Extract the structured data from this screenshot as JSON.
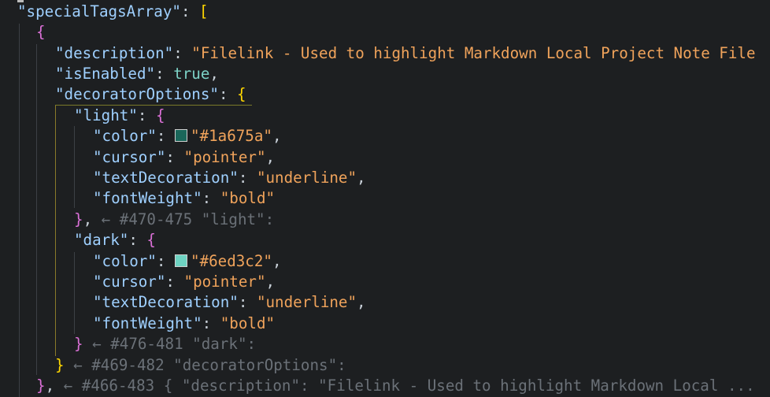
{
  "code": {
    "line1": {
      "key": "\"specialTagsArray\"",
      "colon": ": ",
      "open": "["
    },
    "line2": {
      "open": "{"
    },
    "line3": {
      "key": "\"description\"",
      "colon": ": ",
      "value": "\"Filelink - Used to highlight Markdown Local Project Note File"
    },
    "line4": {
      "key": "\"isEnabled\"",
      "colon": ": ",
      "value": "true",
      "comma": ","
    },
    "line5": {
      "key": "\"decoratorOptions\"",
      "colon": ": ",
      "open": "{"
    },
    "line6": {
      "key": "\"light\"",
      "colon": ": ",
      "open": "{"
    },
    "line7": {
      "key": "\"color\"",
      "colon": ": ",
      "swatch": "#1a675a",
      "value": "\"#1a675a\"",
      "comma": ","
    },
    "line8": {
      "key": "\"cursor\"",
      "colon": ": ",
      "value": "\"pointer\"",
      "comma": ","
    },
    "line9": {
      "key": "\"textDecoration\"",
      "colon": ": ",
      "value": "\"underline\"",
      "comma": ","
    },
    "line10": {
      "key": "\"fontWeight\"",
      "colon": ": ",
      "value": "\"bold\""
    },
    "line11": {
      "close": "}",
      "comma": ",",
      "hint": " ← #470-475 \"light\":"
    },
    "line12": {
      "key": "\"dark\"",
      "colon": ": ",
      "open": "{"
    },
    "line13": {
      "key": "\"color\"",
      "colon": ": ",
      "swatch": "#6ed3c2",
      "value": "\"#6ed3c2\"",
      "comma": ","
    },
    "line14": {
      "key": "\"cursor\"",
      "colon": ": ",
      "value": "\"pointer\"",
      "comma": ","
    },
    "line15": {
      "key": "\"textDecoration\"",
      "colon": ": ",
      "value": "\"underline\"",
      "comma": ","
    },
    "line16": {
      "key": "\"fontWeight\"",
      "colon": ": ",
      "value": "\"bold\""
    },
    "line17": {
      "close": "}",
      "hint": " ← #476-481 \"dark\":"
    },
    "line18": {
      "close": "}",
      "hint": " ← #469-482 \"decoratorOptions\":"
    },
    "line19": {
      "close": "}",
      "comma": ",",
      "hint": " ← #466-483 { \"description\": \"Filelink - Used to highlight Markdown Local ..."
    }
  }
}
